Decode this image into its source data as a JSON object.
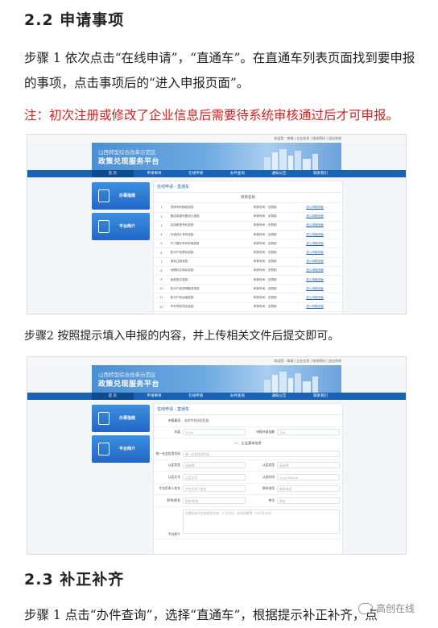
{
  "section1": {
    "heading": "2.2 申请事项",
    "step1": "步骤 1  依次点击“在线申请”，“直通车”。在直通车列表页面找到要申报的事项，点击事项后的“进入申报页面”。",
    "note": "注：初次注册或修改了企业信息后需要待系统审核通过后才可申报。"
  },
  "step2": "步骤2 按照提示填入申报的内容，并上传相关文件后提交即可。",
  "section2": {
    "heading": "2.3 补正补齐",
    "step1": "步骤 1  点击“办件查询”，选择“直通车”，根据提示补正补齐，点"
  },
  "portal": {
    "topbar": "欢迎您：商城  |  企业信息  |  修改密码  |  退出系统",
    "title_small": "山西转型综合改革示范区",
    "title_big": "政策兑现服务平台",
    "nav": [
      "首 页",
      "申请事项",
      "在线申请",
      "办件查询",
      "通知公告",
      "联系我们"
    ],
    "side_cards": [
      "办事指南",
      "平台简介"
    ],
    "breadcrumb": "在线申请 - 直通车",
    "list_header": "项目名称",
    "rows": [
      {
        "n": "1",
        "name": "发明专利授权奖励",
        "date": "申报时间：无限制",
        "link": "进入申报页面"
      },
      {
        "n": "2",
        "name": "集成电路布图设计奖励",
        "date": "申报时间：无限制",
        "link": "进入申报页面"
      },
      {
        "n": "3",
        "name": "实用新型专利奖励",
        "date": "申报时间：无限制",
        "link": "进入申报页面"
      },
      {
        "n": "4",
        "name": "外观设计专利奖励",
        "date": "申报时间：无限制",
        "link": "进入申报页面"
      },
      {
        "n": "5",
        "name": "PCT国际专利申请奖励",
        "date": "申报时间：无限制",
        "link": "进入申报页面"
      },
      {
        "n": "6",
        "name": "知识产权贯标奖励",
        "date": "申报时间：无限制",
        "link": "进入申报页面"
      },
      {
        "n": "7",
        "name": "商标注册奖励",
        "date": "申报时间：无限制",
        "link": "进入申报页面"
      },
      {
        "n": "8",
        "name": "地理标志商标奖励",
        "date": "申报时间：无限制",
        "link": "进入申报页面"
      },
      {
        "n": "9",
        "name": "版权登记奖励",
        "date": "申报时间：无限制",
        "link": "进入申报页面"
      },
      {
        "n": "10",
        "name": "知识产权质押融资奖励",
        "date": "申报时间：无限制",
        "link": "进入申报页面"
      },
      {
        "n": "11",
        "name": "知识产权运营奖励",
        "date": "申报时间：无限制",
        "link": "进入申报页面"
      },
      {
        "n": "12",
        "name": "专利导航项目奖励",
        "date": "申报时间：无限制",
        "link": "进入申报页面"
      },
      {
        "n": "13",
        "name": "知识产权服务机构奖励",
        "date": "申报时间：无限制",
        "link": "进入申报页面"
      }
    ],
    "form": {
      "r1_label": "申报事项",
      "r1_value": "发明专利授权奖励",
      "r2_label": "年度",
      "r2_value": "2019",
      "r2b_label": "申报补助金额",
      "r2b_value": "万元",
      "section_title": "一、企业基本信息",
      "r3_label": "统一社会信用代码",
      "r3_value": "统一社会信用代码",
      "r4_label": "认定类型",
      "r4_value": "请选择",
      "r4b_label": "认定类型",
      "r4b_value": "请选择",
      "r5_label": "认定文号",
      "r5_value": "认定文号",
      "r5b_label": "认定时间",
      "r5b_value": "yyyy-MM-dd",
      "r6_label": "平台负责人姓名",
      "r6_value": "平台负责人姓名",
      "r6b_label": "联系电话",
      "r6b_value": "联系电话",
      "r7_label": "职称/职务",
      "r7_value": "职称/职务",
      "r7b_label": "单位",
      "r7b_value": "单位",
      "r8_label": "平台简介",
      "r8_value": "主要包括平台的研发方向、人才队伍、研发成果等（300字以内）"
    }
  },
  "watermark": "高创在线"
}
